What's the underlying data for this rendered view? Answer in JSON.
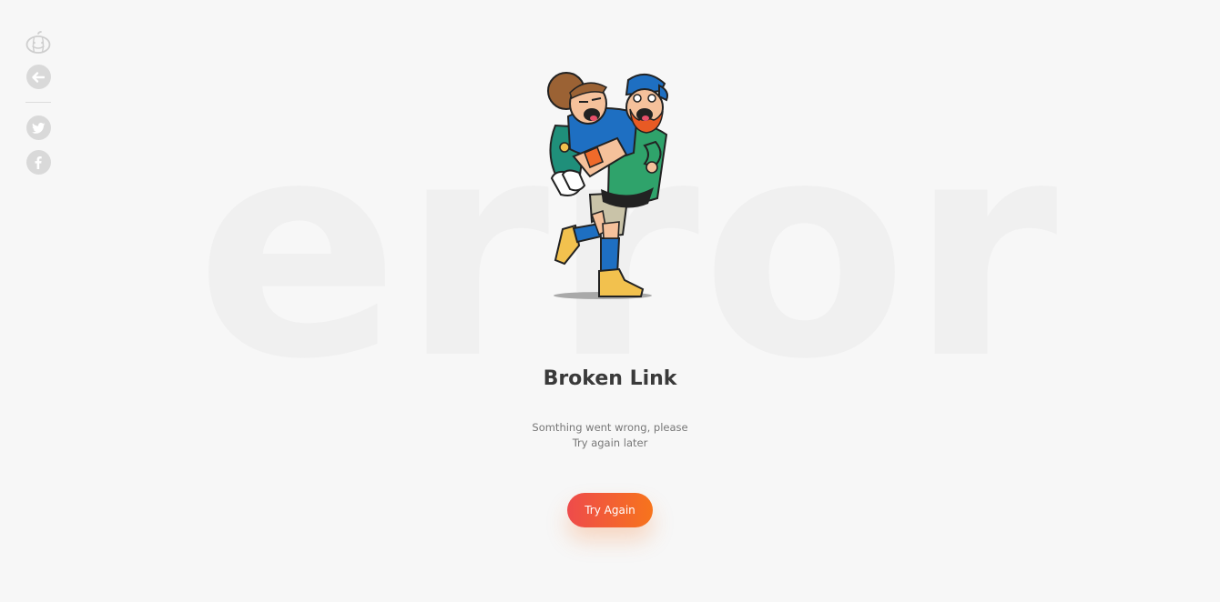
{
  "background_word": "error",
  "sidebar": {
    "items": [
      {
        "name": "pumpkin-logo-icon"
      },
      {
        "name": "back-arrow-icon"
      },
      {
        "name": "twitter-icon"
      },
      {
        "name": "facebook-icon"
      }
    ]
  },
  "main": {
    "title": "Broken Link",
    "message_line1": "Somthing went wrong, please",
    "message_line2": "Try again later",
    "button_label": "Try Again"
  },
  "colors": {
    "background": "#f7f7f7",
    "button_gradient_start": "#ee4b4b",
    "button_gradient_end": "#f7741c",
    "icon_gray": "#d9d9d9"
  }
}
